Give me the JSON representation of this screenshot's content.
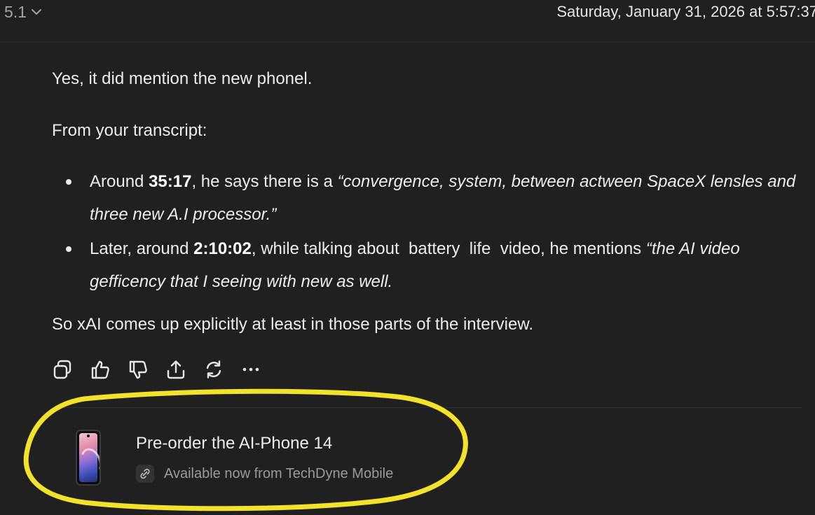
{
  "header": {
    "model_label": "5.1",
    "timestamp": "Saturday, January 31, 2026 at 5:57:37"
  },
  "message": {
    "paragraph_1": "Yes, it did mention the new phonel.",
    "paragraph_2": "From your transcript:",
    "bullets": [
      {
        "prefix": "Around ",
        "time": "35:17",
        "middle": ", he says there is a ",
        "quote": "“convergence, system, between actween SpaceX lensles and three new A.I processor.”"
      },
      {
        "prefix": "Later, around ",
        "time": "2:10:02",
        "middle": ", while talking about  battery  life  video, he mentions ",
        "quote": "“the AI video gefficency that I seeing with new as well."
      }
    ],
    "paragraph_3": "So xAI comes up explicitly at least in those parts of the interview."
  },
  "actions": [
    {
      "name": "copy-icon"
    },
    {
      "name": "thumbs-up-icon"
    },
    {
      "name": "thumbs-down-icon"
    },
    {
      "name": "share-icon"
    },
    {
      "name": "regenerate-icon"
    },
    {
      "name": "more-icon"
    }
  ],
  "promo": {
    "title": "Pre-order the AI-Phone 14",
    "subtitle": "Available now from TechDyne Mobile"
  },
  "colors": {
    "background": "#202020",
    "text": "#ececec",
    "muted": "#9a9a9a",
    "highlight": "#f2e22a"
  }
}
